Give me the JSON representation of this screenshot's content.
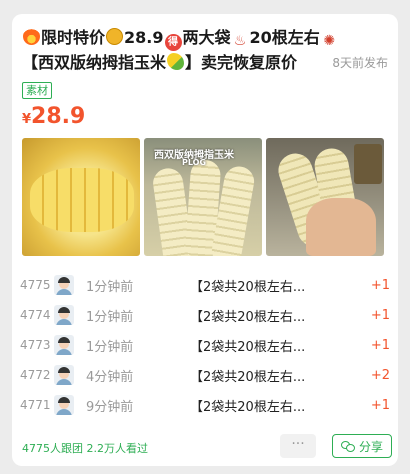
{
  "post": {
    "title_line1_a": "限时特价",
    "title_line1_b": "28.9",
    "title_line1_c": "两大袋",
    "title_line1_d": "20根左右",
    "title_line2": "【西双版纳拇指玉米",
    "title_line2_b": "】卖完恢复原价",
    "posted_ago": "8天前发布",
    "tag": "素材",
    "currency": "¥",
    "price": "28.9"
  },
  "photos": {
    "photo2_label": "西双版纳拇指玉米",
    "photo2_sub": "PLOG"
  },
  "orders": [
    {
      "idx": "4775",
      "time": "1分钟前",
      "desc": "【2袋共20根左右...",
      "count": "+1"
    },
    {
      "idx": "4774",
      "time": "1分钟前",
      "desc": "【2袋共20根左右...",
      "count": "+1"
    },
    {
      "idx": "4773",
      "time": "1分钟前",
      "desc": "【2袋共20根左右...",
      "count": "+1"
    },
    {
      "idx": "4772",
      "time": "4分钟前",
      "desc": "【2袋共20根左右...",
      "count": "+2"
    },
    {
      "idx": "4771",
      "time": "9分钟前",
      "desc": "【2袋共20根左右...",
      "count": "+1"
    }
  ],
  "footer": {
    "stats": "4775人跟团  2.2万人看过",
    "more": "···",
    "share": "分享"
  },
  "colors": {
    "accent_red": "#f2542d",
    "accent_green": "#2eae54"
  },
  "icons": [
    "fire-icon",
    "money-bag-icon",
    "de-badge-icon",
    "hot-springs-icon",
    "anger-icon",
    "corn-icon",
    "wechat-icon"
  ]
}
